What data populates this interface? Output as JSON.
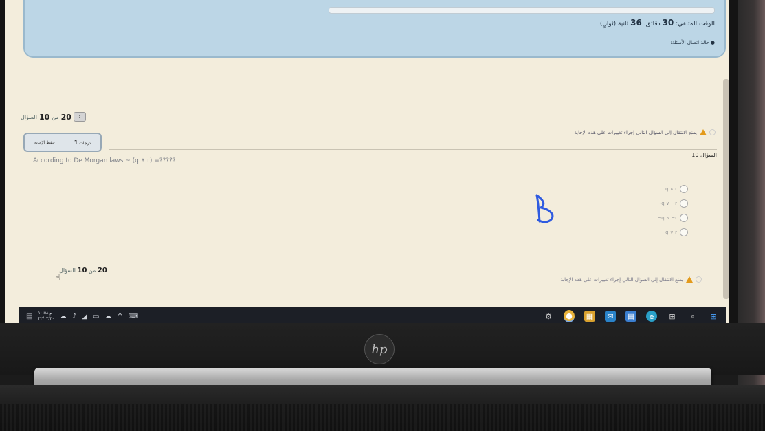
{
  "banner": {
    "time_text": "الوقت المتبقي: 30 دقائق، 36 ثانية (ثوانٍ).",
    "time_prefix": "الوقت المتبقي:",
    "minutes": "30",
    "minutes_unit": "دقائق،",
    "seconds": "36",
    "seconds_unit": "ثانية (ثوانٍ).",
    "question_state": "● حالة اتصال الأسئلة:"
  },
  "question": {
    "counter_prefix": "السؤال",
    "number": "10",
    "counter_of": "من",
    "total": "20",
    "prev_label": "‹",
    "points": "1",
    "points_unit": "درجات",
    "flag_label": "حفظ الإجابة",
    "warning": "يمنع الانتقال إلى السؤال التالي إجراء تغييرات على هذه الإجابة",
    "title": "السؤال 10",
    "text": "According to De Morgan laws ~ (q ∧ r) ≡?????",
    "options": [
      "q ∧ r",
      "~q ∨ ~r",
      "~q ∧ ~r",
      "q ∨ r"
    ]
  },
  "handwriting": {
    "letter": "B",
    "color": "#2f5be0"
  },
  "taskbar": {
    "clock_time": "م ١٠:٥٨",
    "clock_date": "٢٢/٠٣/٢٠",
    "apps": [
      "settings-icon",
      "chrome-icon",
      "store-icon",
      "mail-icon",
      "calendar-icon",
      "edge-icon",
      "task-view-icon",
      "search-icon",
      "start-icon"
    ]
  },
  "brand": {
    "logo": "hp"
  }
}
